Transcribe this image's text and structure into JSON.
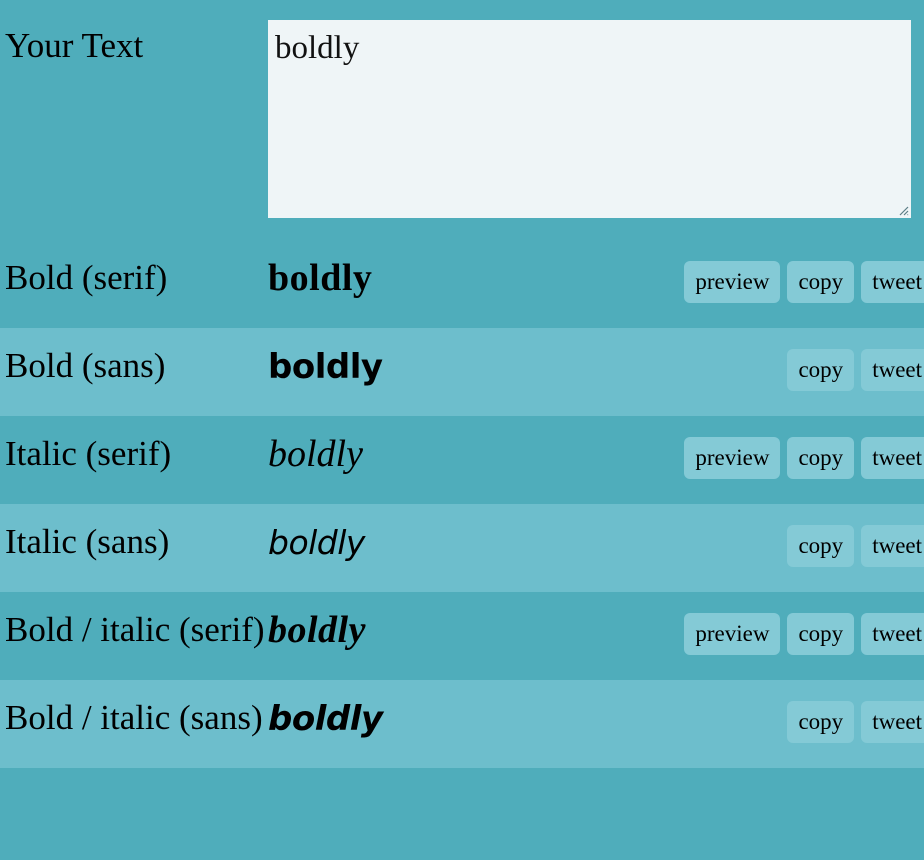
{
  "theme": {
    "page_bg": "#4fadbb",
    "row_dark": "#4fadbb",
    "row_light": "#6dbecc",
    "textarea_bg": "#eff5f7",
    "button_bg": "#84cad6",
    "text_color": "#000000"
  },
  "input_row": {
    "label": "Your Text",
    "textarea_value": "boldly",
    "textarea_placeholder": "",
    "resize_handle": "resize-grip-icon"
  },
  "buttons": {
    "preview": "preview",
    "copy": "copy",
    "tweet": "tweet"
  },
  "rows": [
    {
      "label": "Bold (serif)",
      "sample": "boldly",
      "style_class": "s-bold-serif",
      "shade": "dark",
      "has_preview": true
    },
    {
      "label": "Bold (sans)",
      "sample": "boldly",
      "style_class": "s-bold-sans",
      "shade": "light",
      "has_preview": false
    },
    {
      "label": "Italic (serif)",
      "sample": "boldly",
      "style_class": "s-italic-serif",
      "shade": "dark",
      "has_preview": true
    },
    {
      "label": "Italic (sans)",
      "sample": "boldly",
      "style_class": "s-italic-sans",
      "shade": "light",
      "has_preview": false
    },
    {
      "label": "Bold / italic (serif)",
      "sample": "boldly",
      "style_class": "s-bolditalic-serif",
      "shade": "dark",
      "has_preview": true
    },
    {
      "label": "Bold / italic (sans)",
      "sample": "boldly",
      "style_class": "s-bolditalic-sans",
      "shade": "light",
      "has_preview": false
    }
  ]
}
